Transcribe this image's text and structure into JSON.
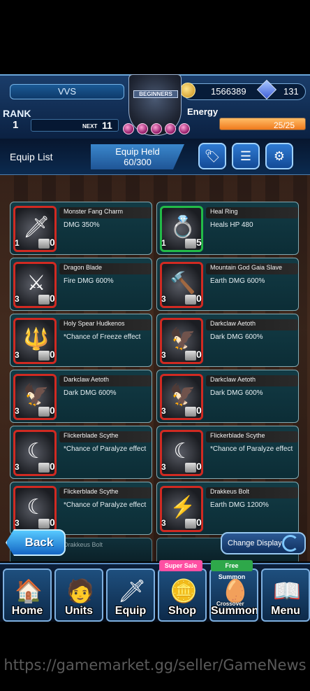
{
  "header": {
    "player_name": "VVS",
    "rank_label": "RANK",
    "rank": "1",
    "next_label": "NEXT",
    "next_value": "11",
    "gold": "1566389",
    "gems": "131",
    "energy_label": "Energy",
    "energy": "25/25",
    "energy_fraction": 1.0,
    "emblem_text": "BEGINNERS"
  },
  "equip_bar": {
    "title": "Equip List",
    "held_label": "Equip Held",
    "held_value": "60/300",
    "buttons": [
      "tag-icon",
      "filter-icon",
      "gear-icon"
    ]
  },
  "items": [
    {
      "name": "Monster Fang Charm",
      "desc": "DMG 350%",
      "rarity": "1",
      "count": "0",
      "frame": "red",
      "art": "🗡"
    },
    {
      "name": "Heal Ring",
      "desc": "Heals HP 480",
      "rarity": "1",
      "count": "5",
      "frame": "green",
      "art": "💍"
    },
    {
      "name": "Dragon Blade",
      "desc": "Fire DMG 600%",
      "rarity": "3",
      "count": "0",
      "frame": "red",
      "art": "⚔"
    },
    {
      "name": "Mountain God Gaia Slave",
      "desc": "Earth DMG 600%",
      "rarity": "3",
      "count": "0",
      "frame": "red",
      "art": "🔨"
    },
    {
      "name": "Holy Spear Hudkenos",
      "desc": "*Chance of Freeze effect",
      "rarity": "3",
      "count": "0",
      "frame": "red",
      "art": "🔱"
    },
    {
      "name": "Darkclaw Aetoth",
      "desc": "Dark DMG 600%",
      "rarity": "3",
      "count": "0",
      "frame": "red",
      "art": "🦅"
    },
    {
      "name": "Darkclaw Aetoth",
      "desc": "Dark DMG 600%",
      "rarity": "3",
      "count": "0",
      "frame": "red",
      "art": "🦅"
    },
    {
      "name": "Darkclaw Aetoth",
      "desc": "Dark DMG 600%",
      "rarity": "3",
      "count": "0",
      "frame": "red",
      "art": "🦅"
    },
    {
      "name": "Flickerblade Scythe",
      "desc": "*Chance of Paralyze effect",
      "rarity": "3",
      "count": "0",
      "frame": "red",
      "art": "☾"
    },
    {
      "name": "Flickerblade Scythe",
      "desc": "*Chance of Paralyze effect",
      "rarity": "3",
      "count": "0",
      "frame": "red",
      "art": "☾"
    },
    {
      "name": "Flickerblade Scythe",
      "desc": "*Chance of Paralyze effect",
      "rarity": "3",
      "count": "0",
      "frame": "red",
      "art": "☾"
    },
    {
      "name": "Drakkeus Bolt",
      "desc": "Earth DMG 1200%",
      "rarity": "3",
      "count": "0",
      "frame": "red",
      "art": "⚡"
    }
  ],
  "partial_item": {
    "name": "Drakkeus Bolt"
  },
  "actions": {
    "back": "Back",
    "change_display": "Change Display"
  },
  "nav": [
    {
      "label": "Home",
      "art": "🏠"
    },
    {
      "label": "Units",
      "art": "🧑"
    },
    {
      "label": "Equip",
      "art": "🗡"
    },
    {
      "label": "Shop",
      "art": "🪙"
    },
    {
      "label": "Summon",
      "art": "🥚"
    },
    {
      "label": "Menu",
      "art": "📖"
    }
  ],
  "badges": {
    "super_sale": "Super Sale",
    "free_summon": "Free Summon",
    "crossover": "Crossover"
  },
  "watermark": "https://gamemarket.gg/seller/GameNews",
  "colors": {
    "accent": "#2f7bd3",
    "frame_red": "#d02a22",
    "frame_green": "#22bb48",
    "energy": "#f07a1d"
  }
}
